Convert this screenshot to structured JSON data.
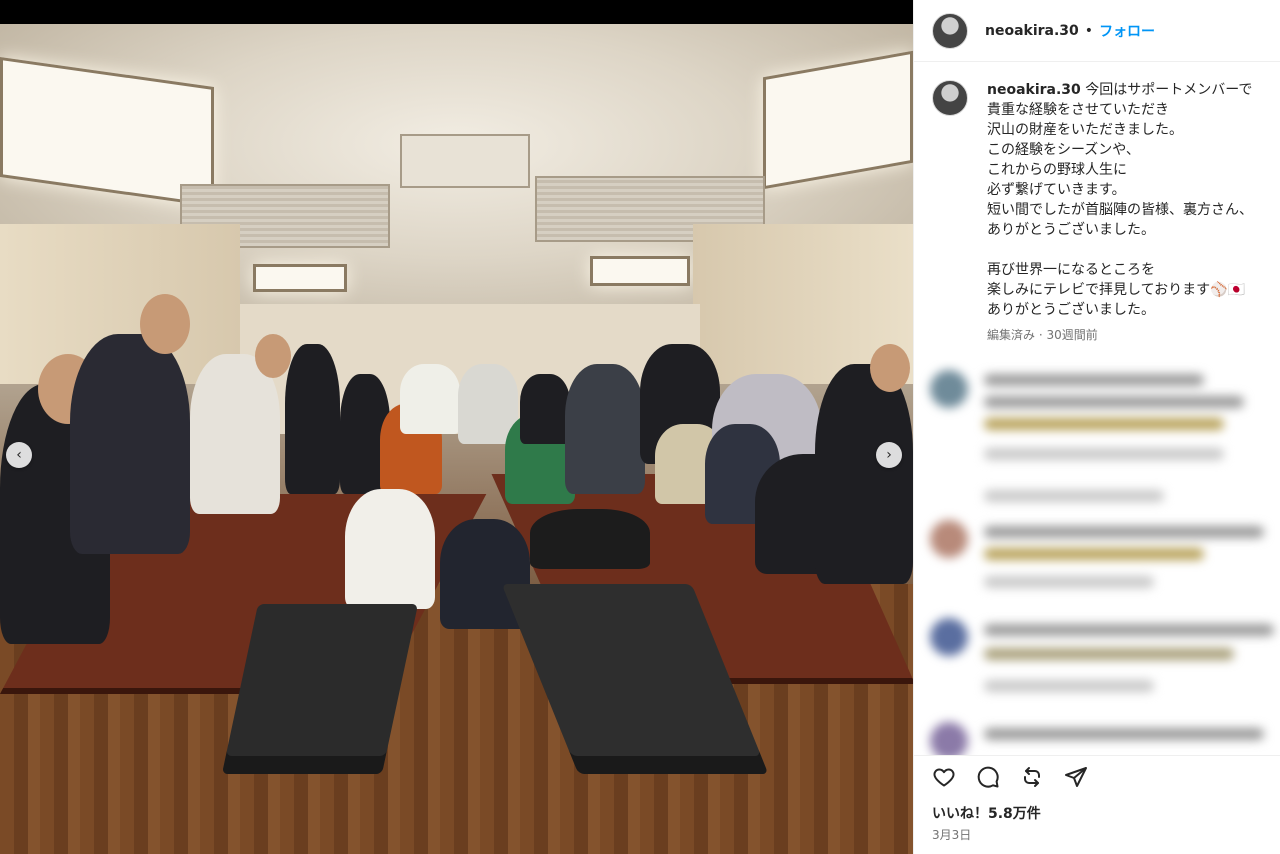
{
  "post": {
    "username": "neoakira.30",
    "separator": "•",
    "follow_label": "フォロー",
    "caption_lines": [
      "今回はサポートメンバーで",
      "貴重な経験をさせていただき",
      "沢山の財産をいただきました。",
      "この経験をシーズンや、",
      "これからの野球人生に",
      "必ず繋げていきます。",
      "短い間でしたが首脳陣の皆様、裏方さん、",
      "ありがとうございました。",
      "",
      "再び世界一になるところを",
      "楽しみにテレビで拝見しております⚾🇯🇵",
      "ありがとうございました。"
    ],
    "edited_label": "編集済み",
    "meta_separator": "·",
    "time_ago": "30週間前",
    "likes": "いいね！5.8万件",
    "date": "3月3日"
  },
  "icons": {
    "prev": "chevron-left-icon",
    "next": "chevron-right-icon",
    "like": "heart-icon",
    "comment": "comment-icon",
    "repost": "repost-icon",
    "share": "share-icon"
  },
  "colors": {
    "follow": "#0095f6",
    "text": "#262626",
    "muted": "#737373"
  }
}
